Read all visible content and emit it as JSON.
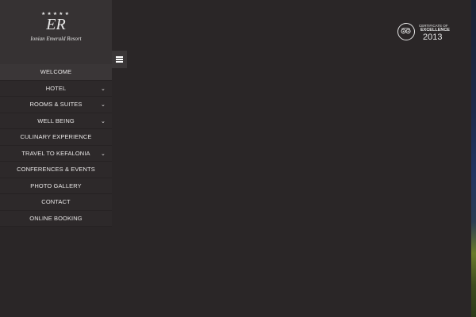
{
  "brand": {
    "stars": "★★★★★",
    "monogram": "ER",
    "name": "Ionian Emerald Resort"
  },
  "menu_toggle": {
    "icon": "hamburger-icon"
  },
  "menu": {
    "items": [
      {
        "label": "WELCOME",
        "has_submenu": false,
        "active": true
      },
      {
        "label": "HOTEL",
        "has_submenu": true,
        "active": false
      },
      {
        "label": "ROOMS & SUITES",
        "has_submenu": true,
        "active": false
      },
      {
        "label": "WELL BEING",
        "has_submenu": true,
        "active": false
      },
      {
        "label": "CULINARY EXPERIENCE",
        "has_submenu": false,
        "active": false
      },
      {
        "label": "TRAVEL TO KEFALONIA",
        "has_submenu": true,
        "active": false
      },
      {
        "label": "CONFERENCES & EVENTS",
        "has_submenu": false,
        "active": false
      },
      {
        "label": "PHOTO GALLERY",
        "has_submenu": false,
        "active": false
      },
      {
        "label": "CONTACT",
        "has_submenu": false,
        "active": false
      },
      {
        "label": "ONLINE BOOKING",
        "has_submenu": false,
        "active": false
      }
    ],
    "chevron_glyph": "⌄"
  },
  "award": {
    "icon": "tripadvisor-owl-icon",
    "certificate_label": "CERTIFICATE OF",
    "excellence_label": "EXCELLENCE",
    "year": "2013"
  },
  "colors": {
    "background": "#2a2627",
    "sidebar_logo_bg": "#363233",
    "menu_item_bg": "#2d292a",
    "menu_active_bg": "#3a3637",
    "text": "#e8e6e6"
  }
}
